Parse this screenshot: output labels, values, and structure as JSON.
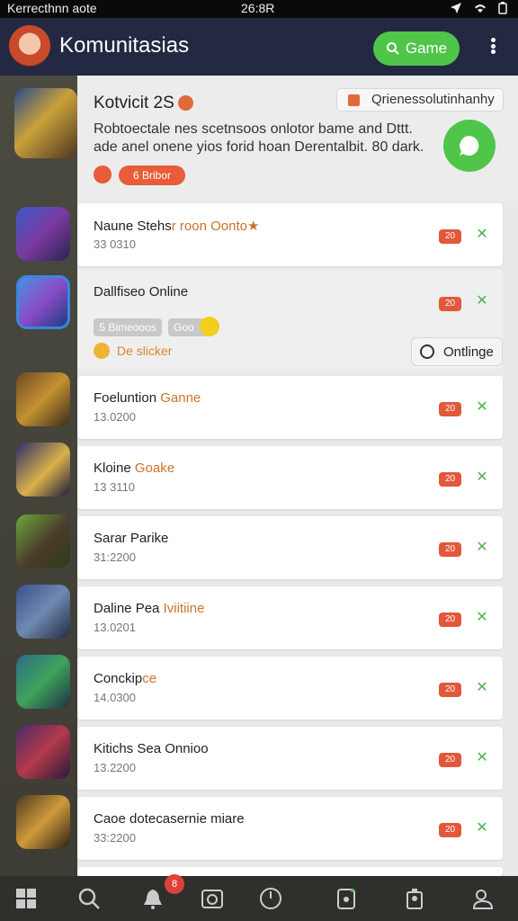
{
  "status_bar": {
    "left": "Kerrecthnn aote",
    "center": "26:8R"
  },
  "header": {
    "title": "Komunitasias",
    "game_button": "Game",
    "brand_color": "#232942",
    "accent_color": "#4fc54a"
  },
  "featured": {
    "title": "Kotvicit  2S",
    "chip_label": "Qrienessolutinhanhy",
    "description": "Robtoectale nes scetnsoos onlotor bame and Dttt. ade anel onene yios forid hoan Derentalbit. 80 dark.",
    "tag_label": "6 Bribor"
  },
  "list": {
    "items": [
      {
        "name": "Naune Stehs",
        "name_accent": "r roon Oonto★",
        "number": "33 0310",
        "score": "20"
      },
      {
        "name": "Dallfiseo Online",
        "name_accent": "",
        "number": "",
        "score": "20"
      },
      {
        "name": "Foeluntion ",
        "name_accent": "Ganne",
        "number": "13.0200",
        "score": "20"
      },
      {
        "name": "Kloine ",
        "name_accent": "Goake",
        "number": "13 3110",
        "score": "20"
      },
      {
        "name": "Sarar Parike",
        "name_accent": "",
        "number": "31:2200",
        "score": "20"
      },
      {
        "name": "Daline Pea ",
        "name_accent": "Iviitiine",
        "number": "13.0201",
        "score": "20"
      },
      {
        "name": "Conckip",
        "name_accent": "ce",
        "number": "14.0300",
        "score": "20"
      },
      {
        "name": "Kitichs Sea Onnioo",
        "name_accent": "",
        "number": "13.2200",
        "score": "20"
      },
      {
        "name": "Caoe dotecasernie miare",
        "name_accent": "",
        "number": "33:2200",
        "score": "20"
      }
    ]
  },
  "expanded_item": {
    "chip_a": "5 Bimeooos",
    "chip_b": "Goo",
    "sticker_label": "De slicker",
    "online_button": "Ontlinge"
  },
  "bottom_nav": {
    "items": [
      "home-grid-icon",
      "search-icon",
      "bell-icon",
      "camera-icon",
      "clock-icon",
      "tablet-icon",
      "badge-icon",
      "profile-icon"
    ],
    "notification_count": "8"
  }
}
